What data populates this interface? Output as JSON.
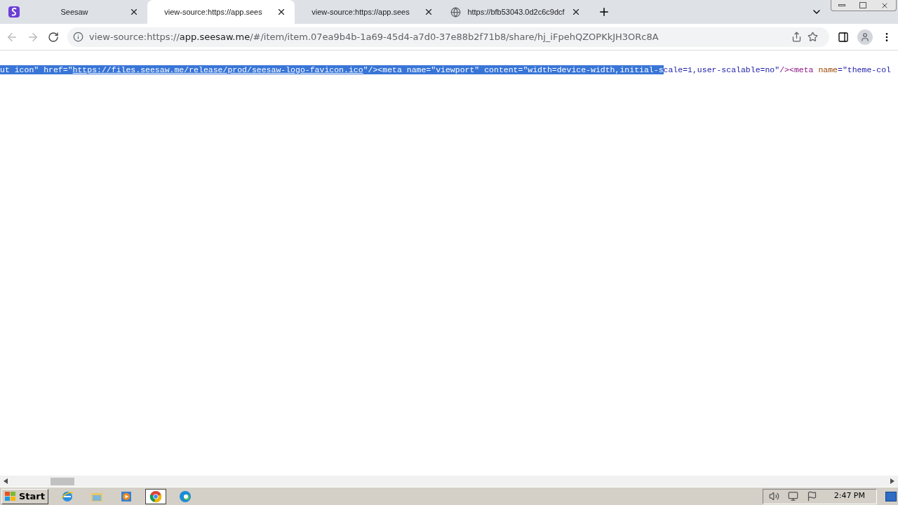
{
  "tabs": [
    {
      "title": "Seesaw",
      "kind": "seesaw",
      "selected": false
    },
    {
      "title": "view-source:https://app.sees",
      "kind": "plain",
      "selected": true
    },
    {
      "title": "view-source:https://app.sees",
      "kind": "plain",
      "selected": false
    },
    {
      "title": "https://bfb53043.0d2c6c9dcf",
      "kind": "web",
      "selected": false
    }
  ],
  "address": {
    "prefix": "view-source:https://",
    "host": "app.seesaw.me",
    "path": "/#/item/item.07ea9b4b-1a69-45d4-a7d0-37e88b2f71b8/share/hj_iFpehQZOPKkJH3ORc8A"
  },
  "source_line": [
    {
      "text": "ut icon\" ",
      "kind": "value",
      "selected": true
    },
    {
      "text": "href",
      "kind": "attr",
      "selected": true
    },
    {
      "text": "=\"",
      "kind": "plain",
      "selected": true
    },
    {
      "text": "https://files.seesaw.me/release/prod/seesaw-logo-favicon.ico",
      "kind": "link",
      "selected": true
    },
    {
      "text": "\"",
      "kind": "plain",
      "selected": true
    },
    {
      "text": "/><meta ",
      "kind": "tag",
      "selected": true
    },
    {
      "text": "name",
      "kind": "attr",
      "selected": true
    },
    {
      "text": "=\"viewport\" ",
      "kind": "value",
      "selected": true
    },
    {
      "text": "content",
      "kind": "attr",
      "selected": true
    },
    {
      "text": "=\"width=device-width,initial-s",
      "kind": "value",
      "selected": true
    },
    {
      "text": "cale=1,user-scalable=no\"",
      "kind": "value",
      "selected": false
    },
    {
      "text": "/><meta ",
      "kind": "tag",
      "selected": false
    },
    {
      "text": "name",
      "kind": "attr",
      "selected": false
    },
    {
      "text": "=\"theme-col",
      "kind": "value",
      "selected": false
    }
  ],
  "taskbar": {
    "start": "Start",
    "apps": [
      {
        "kind": "ie",
        "selected": false
      },
      {
        "kind": "folder",
        "selected": false
      },
      {
        "kind": "media",
        "selected": false
      },
      {
        "kind": "chrome",
        "selected": true
      },
      {
        "kind": "edge",
        "selected": false
      }
    ],
    "clock": "2:47 PM"
  }
}
